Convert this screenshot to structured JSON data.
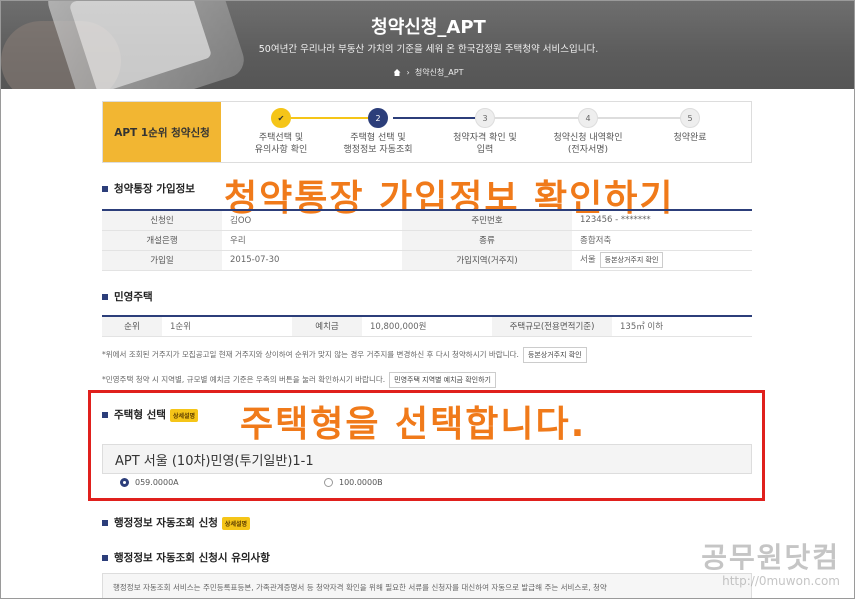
{
  "hero": {
    "title": "청약신청_APT",
    "subtitle": "50여년간 우리나라 부동산 가치의 기준을 세워 온 한국감정원 주택청약 서비스입니다.",
    "breadcrumb": "청약신청_APT"
  },
  "steps": {
    "header": "APT 1순위 청약신청",
    "items": [
      {
        "num": "✔",
        "label1": "주택선택 및",
        "label2": "유의사항 확인",
        "state": "done"
      },
      {
        "num": "2",
        "label1": "주택형 선택 및",
        "label2": "행정정보 자동조회",
        "state": "active"
      },
      {
        "num": "3",
        "label1": "청약자격 확인 및",
        "label2": "입력",
        "state": "todo"
      },
      {
        "num": "4",
        "label1": "청약신청 내역확인",
        "label2": "(전자서명)",
        "state": "todo"
      },
      {
        "num": "5",
        "label1": "청약완료",
        "label2": "",
        "state": "todo"
      }
    ]
  },
  "account_section": {
    "title": "청약통장 가입정보",
    "overlay": "청약통장 가입정보 확인하기",
    "rows": [
      {
        "k1": "신청인",
        "v1": "김OO",
        "k2": "주민번호",
        "v2": "123456 - *******"
      },
      {
        "k1": "개설은행",
        "v1": "우리",
        "k2": "종류",
        "v2": "종합저축"
      },
      {
        "k1": "가입일",
        "v1": "2015-07-30",
        "k2": "가입지역(거주지)",
        "v2": "서울",
        "btn": "등본상거주지 확인"
      }
    ]
  },
  "private_section": {
    "title": "민영주택",
    "row": {
      "k1": "순위",
      "v1": "1순위",
      "k2": "예치금",
      "v2": "10,800,000원",
      "k3": "주택규모(전용면적기준)",
      "v3": "135㎡ 이하"
    },
    "note1": "*위에서 조회된 거주지가 모집공고일 현재 거주지와 상이하여 순위가 맞지 않는 경우 거주지를 변경하신 후 다시 청약하시기 바랍니다.",
    "note1_btn": "등본상거주지 확인",
    "note2": "*민영주택 청약 시 지역별, 규모별 예치금 기준은 우측의 버튼을 눌러 확인하시기 바랍니다.",
    "note2_btn": "민영주택 지역별 예치금 확인하기"
  },
  "housing_section": {
    "title": "주택형 선택",
    "badge": "상세설명",
    "overlay": "주택형을 선택합니다.",
    "header": "APT  서울  (10차)민영(투기일반)1-1",
    "options": [
      "059.0000A",
      "100.0000B"
    ]
  },
  "admin_section": {
    "title": "행정정보 자동조회 신청",
    "badge": "상세설명",
    "sub_title": "행정정보 자동조회 신청시 유의사항",
    "notice": "행정정보 자동조회 서비스는 주민등록표등본, 가족관계증명서 등 청약자격 확인을 위해 필요한 서류를 신청자를 대신하여 자동으로 발급해 주는 서비스로, 청약"
  },
  "watermark": {
    "title": "공무원닷컴",
    "url": "http://0muwon.com"
  },
  "colors": {
    "accent": "#2c3e7a",
    "yellow": "#f2b632",
    "overlay_orange": "#f07a1a",
    "highlight_red": "#e0201d"
  }
}
